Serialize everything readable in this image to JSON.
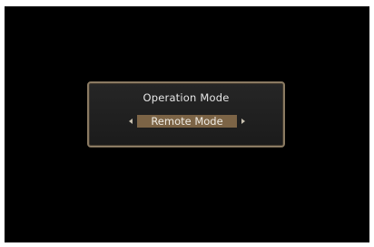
{
  "dialog": {
    "title": "Operation Mode",
    "selected_value": "Remote Mode",
    "left_arrow_icon": "arrow-left-icon",
    "right_arrow_icon": "arrow-right-icon",
    "accent_color": "#7c6446",
    "border_color": "#8a7a62"
  }
}
